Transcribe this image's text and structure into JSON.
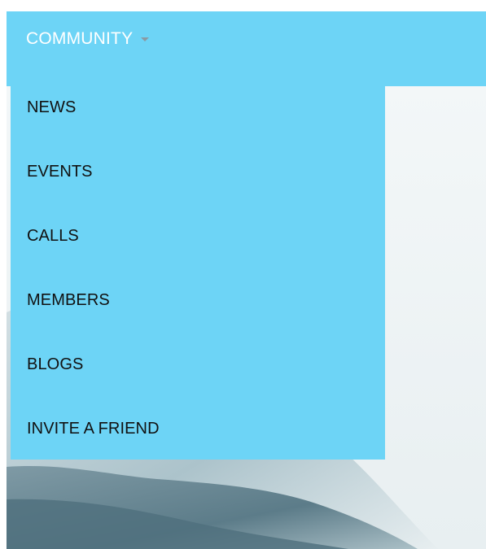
{
  "topbar": {
    "community_label": "COMMUNITY",
    "caret_icon": "chevron-down-icon"
  },
  "menu": {
    "items": [
      {
        "label": "NEWS"
      },
      {
        "label": "EVENTS"
      },
      {
        "label": "CALLS"
      },
      {
        "label": "MEMBERS"
      },
      {
        "label": "BLOGS"
      },
      {
        "label": "INVITE A FRIEND"
      }
    ]
  },
  "colors": {
    "menu_background": "#6dd4f6",
    "topbar_text": "#ffffff",
    "menu_text": "#111111",
    "caret": "#8a9aa3"
  }
}
